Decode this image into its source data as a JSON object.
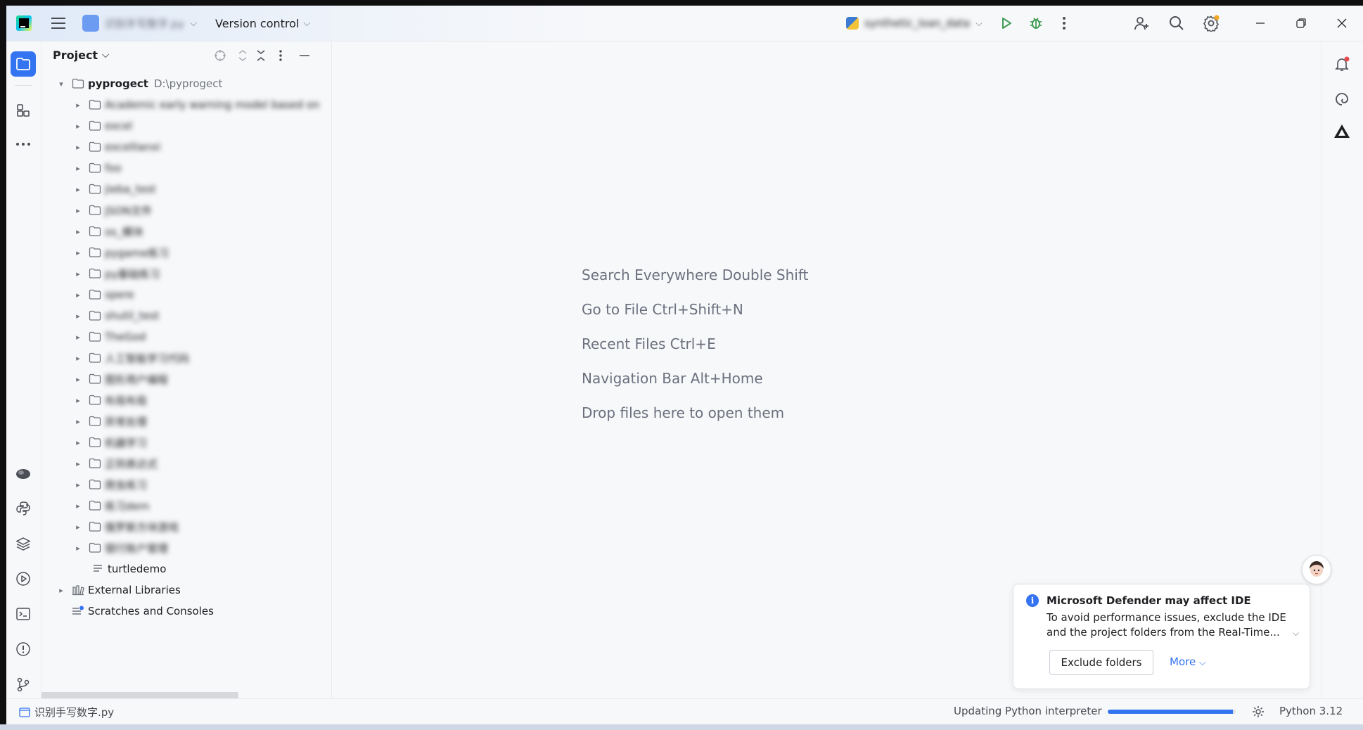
{
  "titlebar": {
    "project_name": "识别手写数字.py",
    "version_control": "Version control",
    "run_config": "synthetic_loan_data"
  },
  "sidebar_panel": {
    "title": "Project"
  },
  "tree": {
    "root_name": "pyprogect",
    "root_path": "D:\\pyprogect",
    "folders": [
      "Academic early warning model based on",
      "excel",
      "excellianxi",
      "foo",
      "jieba_test",
      "JSON文件",
      "os_模块",
      "pygame练习",
      "py基础练习",
      "spere",
      "shutil_test",
      "TheGod",
      "人工智能学习代码",
      "图形用户编程",
      "布局布局",
      "异常处理",
      "机器学习",
      "正则表达式",
      "爬虫练习",
      "练习dem",
      "俄罗斯方块游戏",
      "银行账户管理"
    ],
    "file_turtledemo": "turtledemo",
    "external_libraries": "External Libraries",
    "scratches": "Scratches and Consoles"
  },
  "editor": {
    "hints": [
      "Search Everywhere Double Shift",
      "Go to File Ctrl+Shift+N",
      "Recent Files Ctrl+E",
      "Navigation Bar Alt+Home",
      "Drop files here to open them"
    ]
  },
  "notification": {
    "title": "Microsoft Defender may affect IDE",
    "body": "To avoid performance issues, exclude the IDE and the project folders from the Real-Time...",
    "exclude_button": "Exclude folders",
    "more_link": "More"
  },
  "statusbar": {
    "file": "识别手写数字.py",
    "updating": "Updating Python interpreter",
    "progress": 0.98,
    "interpreter": "Python 3.12"
  },
  "colors": {
    "accent": "#3574f0",
    "run_green": "#3f9c54",
    "notification_badge": "#e5484d",
    "settings_badge": "#f5a623"
  },
  "icons": {
    "project_tool": "folder-icon",
    "structure_tool": "structure-icon",
    "more_tools": "more-horizontal-icon"
  }
}
